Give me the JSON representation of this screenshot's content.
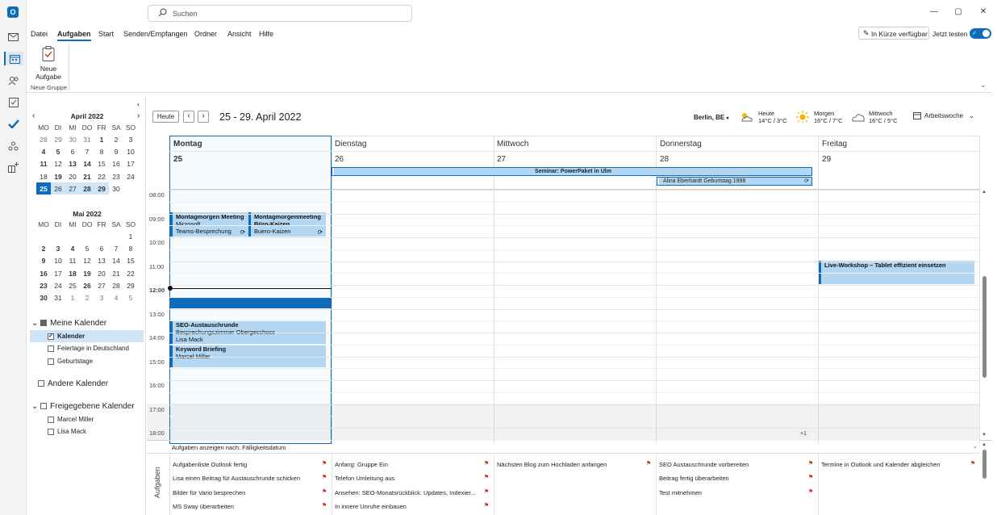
{
  "search": {
    "placeholder": "Suchen"
  },
  "menu": [
    "Datei",
    "Aufgaben",
    "Start",
    "Senden/Empfangen",
    "Ordner",
    "Ansicht",
    "Hilfe"
  ],
  "top_right": {
    "soon": "In Kürze verfügbar",
    "try": "Jetzt testen"
  },
  "ribbon": {
    "new_task": "Neue Aufgabe",
    "new_task_l1": "Neue",
    "new_task_l2": "Aufgabe",
    "group": "Neue Gruppe"
  },
  "minical": [
    {
      "title": "April 2022",
      "days": [
        "MO",
        "DI",
        "MI",
        "DO",
        "FR",
        "SA",
        "SO"
      ],
      "weeks": [
        [
          "28",
          "29",
          "30",
          "31",
          "1",
          "2",
          "3"
        ],
        [
          "4",
          "5",
          "6",
          "7",
          "8",
          "9",
          "10"
        ],
        [
          "11",
          "12",
          "13",
          "14",
          "15",
          "16",
          "17"
        ],
        [
          "18",
          "19",
          "20",
          "21",
          "22",
          "23",
          "24"
        ],
        [
          "25",
          "26",
          "27",
          "28",
          "29",
          "30",
          ""
        ]
      ]
    },
    {
      "title": "Mai 2022",
      "days": [
        "MO",
        "DI",
        "MI",
        "DO",
        "FR",
        "SA",
        "SO"
      ],
      "weeks": [
        [
          "",
          "",
          "",
          "",
          "",
          "",
          "1"
        ],
        [
          "2",
          "3",
          "4",
          "5",
          "6",
          "7",
          "8"
        ],
        [
          "9",
          "10",
          "11",
          "12",
          "13",
          "14",
          "15"
        ],
        [
          "16",
          "17",
          "18",
          "19",
          "20",
          "21",
          "22"
        ],
        [
          "23",
          "24",
          "25",
          "26",
          "27",
          "28",
          "29"
        ],
        [
          "30",
          "31",
          "1",
          "2",
          "3",
          "4",
          "5"
        ]
      ]
    }
  ],
  "folders": {
    "mine": "Meine Kalender",
    "kalender": "Kalender",
    "feiertage": "Feiertage in Deutschland",
    "geburtstage": "Geburtstage",
    "other": "Andere Kalender",
    "shared": "Freigegebene Kalender",
    "marcel": "Marcel Miller",
    "lisa": "Lisa Mack"
  },
  "toolbar": {
    "today": "Heute",
    "range": "25 - 29. April 2022",
    "location": "Berlin, BE",
    "view": "Arbeitswoche"
  },
  "weather": [
    {
      "day": "Heute",
      "temp": "14°C / 3°C"
    },
    {
      "day": "Morgen",
      "temp": "16°C / 7°C"
    },
    {
      "day": "Mittwoch",
      "temp": "16°C / 5°C"
    }
  ],
  "days": [
    {
      "name": "Montag",
      "num": "25"
    },
    {
      "name": "Dienstag",
      "num": "26"
    },
    {
      "name": "Mittwoch",
      "num": "27"
    },
    {
      "name": "Donnerstag",
      "num": "28"
    },
    {
      "name": "Freitag",
      "num": "29"
    }
  ],
  "allday": {
    "seminar": "Seminar: PowerPaket in Ulm",
    "birthday": "Alina Eberhardt Geburtstag 1998"
  },
  "hours": [
    "08:00",
    "09:00",
    "10:00",
    "11:00",
    "12:00",
    "13:00",
    "14:00",
    "15:00",
    "16:00",
    "17:00",
    "18:00"
  ],
  "events": {
    "e1": {
      "title": "Montagmorgen Meeting",
      "l2": "Microsoft",
      "l3": "Teams-Besprechung"
    },
    "e2": {
      "title": "Montagmorgenmeeting",
      "l2": "Büro-Kaizen",
      "l3": "Buero-Kaizen"
    },
    "e3": {
      "title": "SEO-Austauschrunde",
      "l2": "Besprechungszimmer Obergeschoss",
      "l3": "Lisa Mack"
    },
    "e4": {
      "title": "Keyword Briefing",
      "l2": "Marcel Miller"
    },
    "e5": {
      "title": "Live-Workshop – Tablet effizient einsetzen"
    }
  },
  "more": "+1",
  "tasks": {
    "header": "Aufgaben anzeigen nach: Fälligkeitsdatum",
    "label": "Aufgaben",
    "cols": [
      [
        "Aufgabenliste Outlook fertig",
        "Lisa einen Beitrag für Austauschrunde schicken",
        "Bilder für Vario besprechen",
        "MS Sway überarbeiten"
      ],
      [
        "Anfang: Gruppe Ein",
        "Telefon Umleitung aus",
        "Ansehen: SEO-Monatsrückblick: Updates, Indexier...",
        "In innere Unruhe einbauen"
      ],
      [
        "Nächsten Blog zum Hochladen anfangen"
      ],
      [
        "SEO Austauschrunde vorbereiten",
        "Beitrag fertig überarbeiten",
        "Test mitnehmen"
      ],
      [
        "Termine in Outlook und Kalender abgleichen"
      ]
    ]
  },
  "colors": {
    "accent": "#0f6cbd",
    "event": "#b3d7f2",
    "flag": "#c42b1c"
  }
}
